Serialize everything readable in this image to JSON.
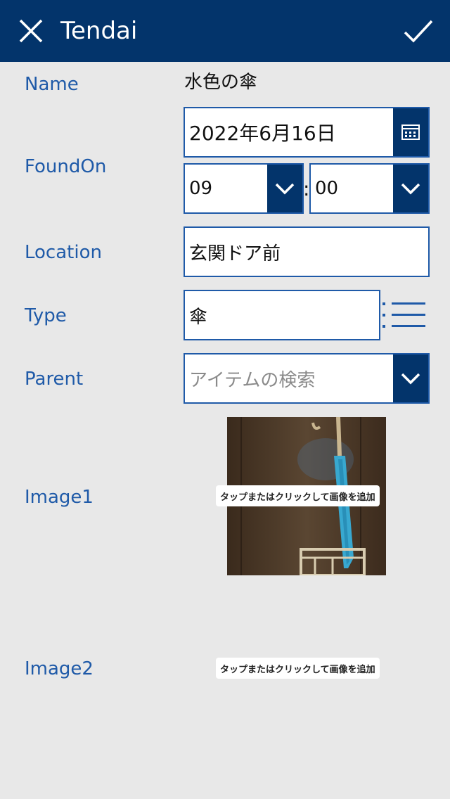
{
  "header": {
    "title": "Tendai"
  },
  "form": {
    "name": {
      "label": "Name",
      "value": "水色の傘"
    },
    "found_on": {
      "label": "FoundOn",
      "date": "2022年6月16日",
      "hour": "09",
      "minute": "00",
      "separator": ":"
    },
    "location": {
      "label": "Location",
      "value": "玄関ドア前"
    },
    "type": {
      "label": "Type",
      "value": "傘"
    },
    "parent": {
      "label": "Parent",
      "placeholder": "アイテムの検索"
    },
    "image1": {
      "label": "Image1",
      "add_text": "タップまたはクリックして画像を追加"
    },
    "image2": {
      "label": "Image2",
      "add_text": "タップまたはクリックして画像を追加"
    }
  },
  "colors": {
    "header_bg": "#03346b",
    "label": "#1f5aa8",
    "background": "#e8e8e8"
  }
}
